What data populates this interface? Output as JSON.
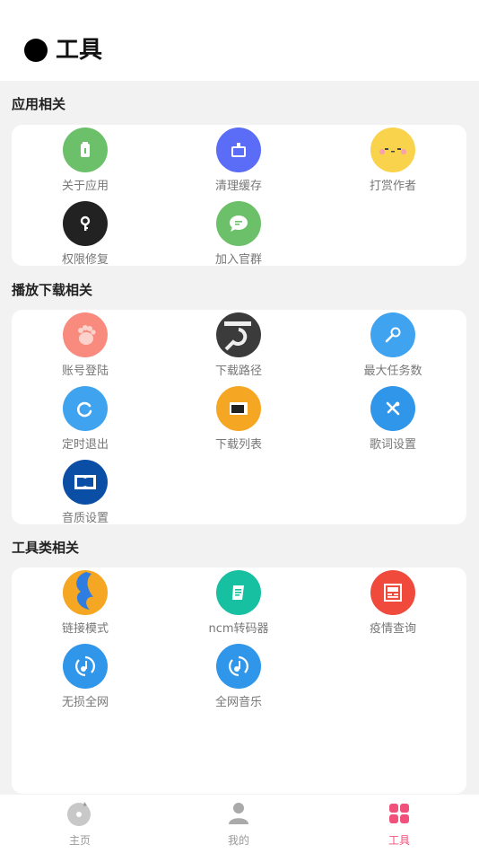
{
  "header": {
    "title": "工具"
  },
  "sections": [
    {
      "title": "应用相关",
      "items": [
        {
          "label": "关于应用",
          "icon": "about-app-icon",
          "color": "#6cc06a"
        },
        {
          "label": "清理缓存",
          "icon": "clean-cache-icon",
          "color": "#5b6cf6"
        },
        {
          "label": "打赏作者",
          "icon": "tip-author-icon",
          "color": "#f9d34c"
        },
        {
          "label": "权限修复",
          "icon": "permission-key-icon",
          "color": "#222222"
        },
        {
          "label": "加入官群",
          "icon": "join-group-icon",
          "color": "#6cc06a"
        }
      ]
    },
    {
      "title": "播放下载相关",
      "items": [
        {
          "label": "账号登陆",
          "icon": "account-login-icon",
          "color": "#f88a7e"
        },
        {
          "label": "下载路径",
          "icon": "download-path-icon",
          "color": "#3b3b3b"
        },
        {
          "label": "最大任务数",
          "icon": "max-tasks-icon",
          "color": "#3fa3ef"
        },
        {
          "label": "定时退出",
          "icon": "timer-exit-icon",
          "color": "#3fa3ef"
        },
        {
          "label": "下载列表",
          "icon": "download-list-icon",
          "color": "#f5a623"
        },
        {
          "label": "歌词设置",
          "icon": "lyrics-settings-icon",
          "color": "#2f96ea"
        },
        {
          "label": "音质设置",
          "icon": "audio-quality-icon",
          "color": "#0b4ea6"
        }
      ]
    },
    {
      "title": "工具类相关",
      "items": [
        {
          "label": "链接模式",
          "icon": "link-mode-icon",
          "color": "#f5a623"
        },
        {
          "label": "ncm转码器",
          "icon": "ncm-converter-icon",
          "color": "#17c0a0"
        },
        {
          "label": "疫情查询",
          "icon": "epidemic-query-icon",
          "color": "#f04a3c"
        },
        {
          "label": "无损全网",
          "icon": "lossless-music-icon",
          "color": "#2f96ea"
        },
        {
          "label": "全网音乐",
          "icon": "all-music-icon",
          "color": "#2f96ea"
        }
      ]
    }
  ],
  "tabbar": {
    "items": [
      {
        "label": "主页",
        "icon": "home-disc-icon"
      },
      {
        "label": "我的",
        "icon": "profile-icon"
      },
      {
        "label": "工具",
        "icon": "tools-grid-icon",
        "active": true
      }
    ],
    "active_color": "#f0507a"
  }
}
